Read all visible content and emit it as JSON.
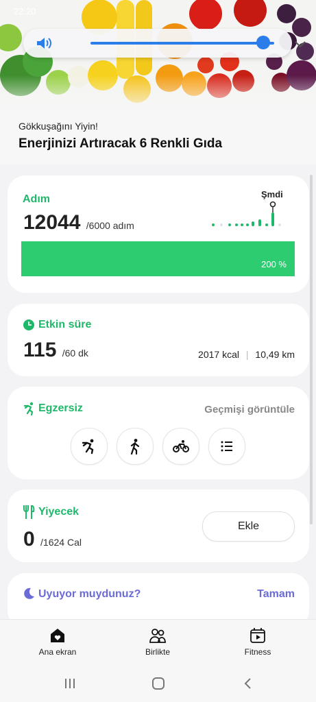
{
  "status_bar": {
    "time": "22:20"
  },
  "volume_panel": {
    "level": 0.94
  },
  "banner": {
    "subtitle": "Gökkuşağını Yiyin!",
    "title": "Enerjinizi Artıracak 6 Renkli Gıda"
  },
  "steps": {
    "title": "Adım",
    "count": "12044",
    "goal": "/6000 adım",
    "now_label": "Şmdi",
    "percent": "200 %",
    "progress": 2.0
  },
  "active_time": {
    "title": "Etkin süre",
    "minutes": "115",
    "goal": "/60 dk",
    "kcal": "2017 kcal",
    "distance": "10,49 km"
  },
  "exercise": {
    "title": "Egzersiz",
    "history_link": "Geçmişi görüntüle",
    "shortcuts": [
      "running-icon",
      "walking-icon",
      "cycling-icon",
      "list-icon"
    ]
  },
  "food": {
    "title": "Yiyecek",
    "calories": "0",
    "goal": "/1624 Cal",
    "add_label": "Ekle"
  },
  "sleep": {
    "question": "Uyuyor muydunuz?",
    "confirm": "Tamam"
  },
  "bottom_nav": [
    {
      "label": "Ana ekran",
      "icon": "home-heart-icon"
    },
    {
      "label": "Birlikte",
      "icon": "people-icon"
    },
    {
      "label": "Fitness",
      "icon": "fitness-video-icon"
    }
  ],
  "colors": {
    "accent_green": "#1fb86b",
    "bar_green": "#2ecc71",
    "sleep_purple": "#6b6bd6",
    "volume_blue": "#2b7de9"
  }
}
